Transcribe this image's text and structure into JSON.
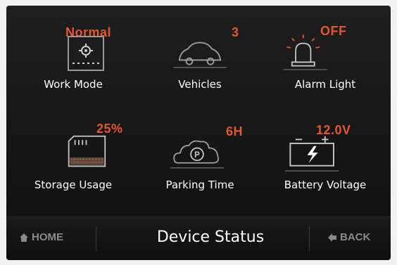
{
  "tiles": [
    {
      "value": "Normal",
      "label": "Work Mode",
      "icon": "work-mode-icon"
    },
    {
      "value": "3",
      "label": "Vehicles",
      "icon": "vehicle-icon"
    },
    {
      "value": "OFF",
      "label": "Alarm Light",
      "icon": "alarm-light-icon"
    },
    {
      "value": "25%",
      "label": "Storage Usage",
      "icon": "storage-icon"
    },
    {
      "value": "6H",
      "label": "Parking Time",
      "icon": "parking-icon"
    },
    {
      "value": "12.0V",
      "label": "Battery Voltage",
      "icon": "battery-icon"
    }
  ],
  "bottom": {
    "home_label": "HOME",
    "title": "Device Status",
    "back_label": "BACK"
  },
  "colors": {
    "accent": "#e4572e",
    "text": "#ffffff",
    "muted": "#8a8a8a"
  }
}
